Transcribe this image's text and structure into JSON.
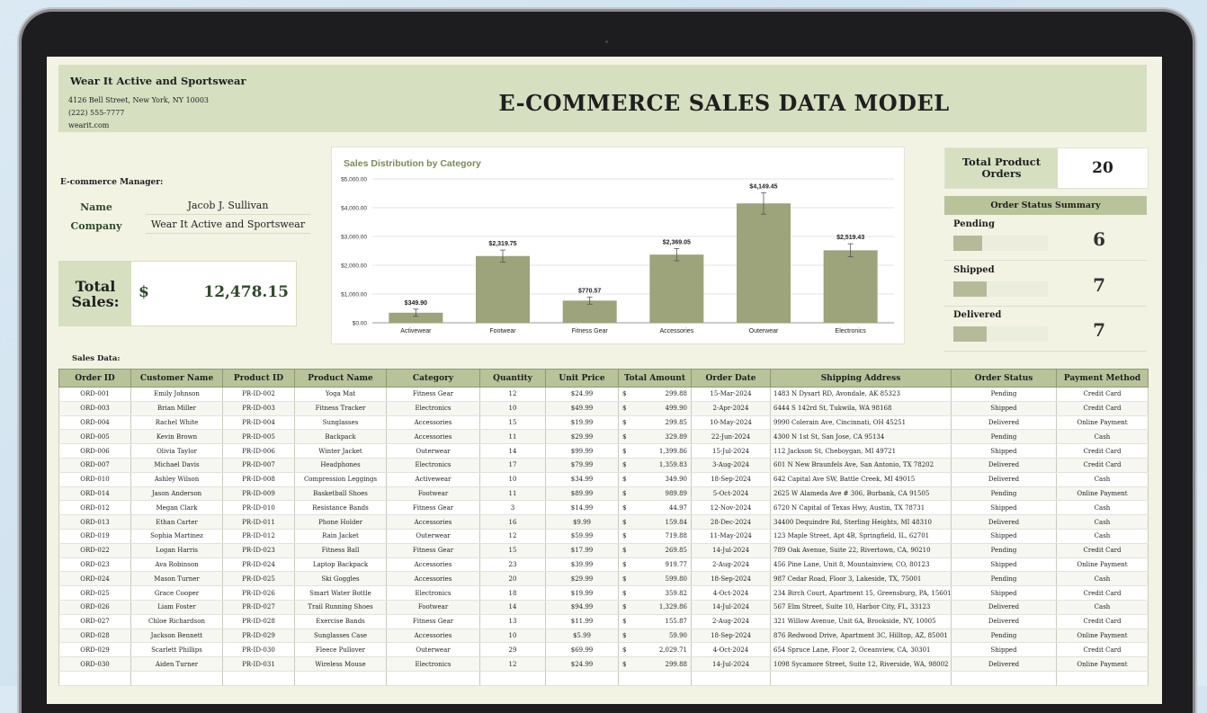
{
  "company": {
    "name": "Wear It Active and Sportswear",
    "address": "4126 Bell Street, New York, NY 10003",
    "phone": "(222) 555-7777",
    "website": "wearit.com"
  },
  "title": "E-COMMERCE SALES DATA MODEL",
  "manager": {
    "heading": "E-commerce Manager:",
    "name_label": "Name",
    "name": "Jacob J. Sullivan",
    "company_label": "Company",
    "company": "Wear It Active and Sportswear"
  },
  "total_sales": {
    "label": "Total Sales:",
    "currency": "$",
    "amount": "12,478.15"
  },
  "total_product_orders": {
    "label": "Total Product Orders",
    "value": "20"
  },
  "order_status_summary": {
    "heading": "Order Status Summary",
    "items": [
      {
        "label": "Pending",
        "value": "6",
        "fraction": 0.3
      },
      {
        "label": "Shipped",
        "value": "7",
        "fraction": 0.35
      },
      {
        "label": "Delivered",
        "value": "7",
        "fraction": 0.35
      }
    ]
  },
  "chart_data": {
    "type": "bar",
    "title": "Sales Distribution by Category",
    "categories": [
      "Activewear",
      "Footwear",
      "Fitness Gear",
      "Accessories",
      "Outerwear",
      "Electronics"
    ],
    "values": [
      349.9,
      2319.75,
      770.57,
      2369.05,
      4149.45,
      2519.43
    ],
    "value_labels": [
      "$349.90",
      "$2,319.75",
      "$770.57",
      "$2,369.05",
      "$4,149.45",
      "$2,519.43"
    ],
    "y_ticks": [
      "$0.00",
      "$1,000.00",
      "$2,000.00",
      "$3,000.00",
      "$4,000.00",
      "$5,000.00"
    ],
    "ylim": [
      0,
      5000
    ],
    "color": "#9da37a",
    "grid": true,
    "error_bars": true
  },
  "sales_data_label": "Sales Data:",
  "table": {
    "columns": [
      "Order ID",
      "Customer Name",
      "Product ID",
      "Product Name",
      "Category",
      "Quantity",
      "Unit Price",
      "Total Amount",
      "Order Date",
      "Shipping Address",
      "Order Status",
      "Payment Method"
    ],
    "rows": [
      [
        "ORD-001",
        "Emily Johnson",
        "PR-ID-002",
        "Yoga Mat",
        "Fitness Gear",
        "12",
        "$24.99",
        "299.88",
        "15-Mar-2024",
        "1483 N Dysart RD, Avondale, AK 85323",
        "Pending",
        "Credit Card"
      ],
      [
        "ORD-003",
        "Brian Miller",
        "PR-ID-003",
        "Fitness Tracker",
        "Electronics",
        "10",
        "$49.99",
        "499.90",
        "2-Apr-2024",
        "6444 S 142rd St, Tukwila, WA 98168",
        "Shipped",
        "Credit Card"
      ],
      [
        "ORD-004",
        "Rachel White",
        "PR-ID-004",
        "Sunglasses",
        "Accessories",
        "15",
        "$19.99",
        "299.85",
        "10-May-2024",
        "9990 Colerain Ave, Cincinnati, OH 45251",
        "Delivered",
        "Online Payment"
      ],
      [
        "ORD-005",
        "Kevin Brown",
        "PR-ID-005",
        "Backpack",
        "Accessories",
        "11",
        "$29.99",
        "329.89",
        "22-Jun-2024",
        "4300 N 1st St, San Jose, CA 95134",
        "Pending",
        "Cash"
      ],
      [
        "ORD-006",
        "Olivia Taylor",
        "PR-ID-006",
        "Winter Jacket",
        "Outerwear",
        "14",
        "$99.99",
        "1,399.86",
        "15-Jul-2024",
        "112 Jackson St, Cheboygan, MI 49721",
        "Shipped",
        "Credit Card"
      ],
      [
        "ORD-007",
        "Michael Davis",
        "PR-ID-007",
        "Headphones",
        "Electronics",
        "17",
        "$79.99",
        "1,359.83",
        "3-Aug-2024",
        "601 N New Braunfels Ave, San Antonio, TX 78202",
        "Delivered",
        "Credit Card"
      ],
      [
        "ORD-010",
        "Ashley Wilson",
        "PR-ID-008",
        "Compression Leggings",
        "Activewear",
        "10",
        "$34.99",
        "349.90",
        "18-Sep-2024",
        "642 Capital Ave SW, Battle Creek, MI 49015",
        "Delivered",
        "Cash"
      ],
      [
        "ORD-014",
        "Jason Anderson",
        "PR-ID-009",
        "Basketball Shoes",
        "Footwear",
        "11",
        "$89.99",
        "989.89",
        "5-Oct-2024",
        "2625 W Alameda Ave # 306, Burbank, CA 91505",
        "Pending",
        "Online Payment"
      ],
      [
        "ORD-012",
        "Megan Clark",
        "PR-ID-010",
        "Resistance Bands",
        "Fitness Gear",
        "3",
        "$14.99",
        "44.97",
        "12-Nov-2024",
        "6720 N Capital of Texas Hwy, Austin, TX 78731",
        "Shipped",
        "Cash"
      ],
      [
        "ORD-013",
        "Ethan Carter",
        "PR-ID-011",
        "Phone Holder",
        "Accessories",
        "16",
        "$9.99",
        "159.84",
        "28-Dec-2024",
        "34400 Dequindre Rd, Sterling Heights, MI 48310",
        "Delivered",
        "Cash"
      ],
      [
        "ORD-019",
        "Sophia Martinez",
        "PR-ID-012",
        "Rain Jacket",
        "Outerwear",
        "12",
        "$59.99",
        "719.88",
        "11-May-2024",
        "123 Maple Street, Apt 4B, Springfield, IL, 62701",
        "Shipped",
        "Cash"
      ],
      [
        "ORD-022",
        "Logan Harris",
        "PR-ID-023",
        "Fitness Ball",
        "Fitness Gear",
        "15",
        "$17.99",
        "269.85",
        "14-Jul-2024",
        "789 Oak Avenue, Suite 22, Rivertown, CA, 90210",
        "Pending",
        "Credit Card"
      ],
      [
        "ORD-023",
        "Ava Robinson",
        "PR-ID-024",
        "Laptop Backpack",
        "Accessories",
        "23",
        "$39.99",
        "919.77",
        "2-Aug-2024",
        "456 Pine Lane, Unit 8, Mountainview, CO, 80123",
        "Shipped",
        "Online Payment"
      ],
      [
        "ORD-024",
        "Mason Turner",
        "PR-ID-025",
        "Ski Goggles",
        "Accessories",
        "20",
        "$29.99",
        "599.80",
        "18-Sep-2024",
        "987 Cedar Road, Floor 3, Lakeside, TX, 75001",
        "Pending",
        "Cash"
      ],
      [
        "ORD-025",
        "Grace Cooper",
        "PR-ID-026",
        "Smart Water Bottle",
        "Electronics",
        "18",
        "$19.99",
        "359.82",
        "4-Oct-2024",
        "234 Birch Court, Apartment 15, Greensburg, PA, 15601",
        "Shipped",
        "Credit Card"
      ],
      [
        "ORD-026",
        "Liam Foster",
        "PR-ID-027",
        "Trail Running Shoes",
        "Footwear",
        "14",
        "$94.99",
        "1,329.86",
        "14-Jul-2024",
        "567 Elm Street, Suite 10, Harbor City, FL, 33123",
        "Delivered",
        "Cash"
      ],
      [
        "ORD-027",
        "Chloe Richardson",
        "PR-ID-028",
        "Exercise Bands",
        "Fitness Gear",
        "13",
        "$11.99",
        "155.87",
        "2-Aug-2024",
        "321 Willow Avenue, Unit 6A, Brookside, NY, 10005",
        "Delivered",
        "Credit Card"
      ],
      [
        "ORD-028",
        "Jackson Bennett",
        "PR-ID-029",
        "Sunglasses Case",
        "Accessories",
        "10",
        "$5.99",
        "59.90",
        "18-Sep-2024",
        "876 Redwood Drive, Apartment 3C, Hilltop, AZ, 85001",
        "Pending",
        "Online Payment"
      ],
      [
        "ORD-029",
        "Scarlett Phillips",
        "PR-ID-030",
        "Fleece Pullover",
        "Outerwear",
        "29",
        "$69.99",
        "2,029.71",
        "4-Oct-2024",
        "654 Spruce Lane, Floor 2, Oceanview, CA, 30301",
        "Shipped",
        "Credit Card"
      ],
      [
        "ORD-030",
        "Aiden Turner",
        "PR-ID-031",
        "Wireless Mouse",
        "Electronics",
        "12",
        "$24.99",
        "299.88",
        "14-Jul-2024",
        "1098 Sycamore Street, Suite 12, Riverside, WA, 98002",
        "Delivered",
        "Online Payment"
      ]
    ]
  }
}
